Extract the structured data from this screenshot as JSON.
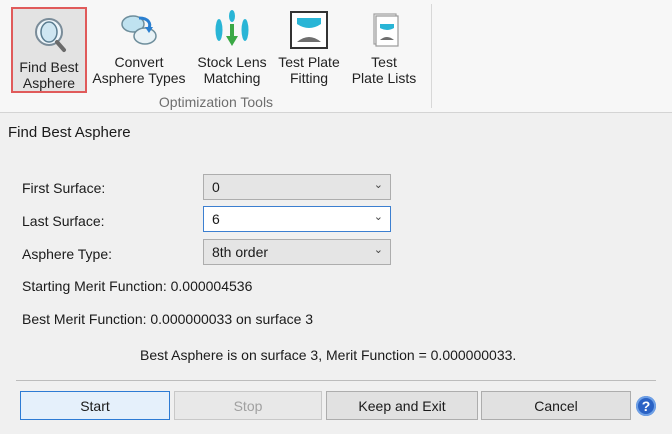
{
  "ribbon": {
    "buttons": [
      {
        "label1": "Find Best",
        "label2": "Asphere",
        "icon": "magnifier-lens-icon"
      },
      {
        "label1": "Convert",
        "label2": "Asphere Types",
        "icon": "convert-lens-icon"
      },
      {
        "label1": "Stock Lens",
        "label2": "Matching",
        "icon": "stock-lens-icon"
      },
      {
        "label1": "Test Plate",
        "label2": "Fitting",
        "icon": "test-plate-icon"
      },
      {
        "label1": "Test",
        "label2": "Plate Lists",
        "icon": "plate-list-icon"
      }
    ],
    "group_label": "Optimization Tools"
  },
  "dialog": {
    "title": "Find Best Asphere",
    "fields": {
      "first_surface": {
        "label": "First Surface:",
        "value": "0"
      },
      "last_surface": {
        "label": "Last Surface:",
        "value": "6"
      },
      "asphere_type": {
        "label": "Asphere Type:",
        "value": "8th order"
      }
    },
    "starting_merit": "Starting Merit Function: 0.000004536",
    "best_merit": "Best Merit Function: 0.000000033 on surface 3",
    "result": "Best Asphere is on surface 3, Merit Function = 0.000000033.",
    "buttons": {
      "start": "Start",
      "stop": "Stop",
      "keep_exit": "Keep and Exit",
      "cancel": "Cancel",
      "help": "?"
    }
  },
  "colors": {
    "active_outline": "#e05a5a",
    "accent_blue": "#2d7bd4",
    "icon_cyan": "#29b5d6",
    "icon_green": "#3aa845"
  }
}
